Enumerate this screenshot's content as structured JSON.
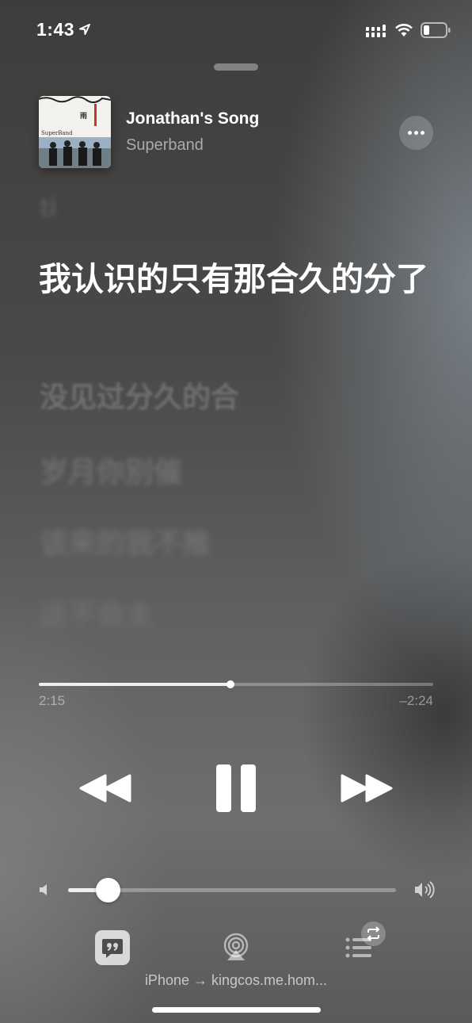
{
  "status_bar": {
    "time": "1:43",
    "icons": [
      "location-arrow-icon",
      "cellular-signal-icon",
      "wifi-icon",
      "battery-icon"
    ]
  },
  "now_playing": {
    "title": "Jonathan's Song",
    "artist": "Superband",
    "album_art": {
      "label": "SuperBand"
    },
    "more_icon": "ellipsis-icon"
  },
  "lyrics": {
    "previous": "ti",
    "current": "我认识的只有那合久的分了",
    "upcoming": [
      "没见过分久的合",
      "岁月你别催",
      "该来的我不推",
      "这不会太"
    ]
  },
  "progress": {
    "elapsed": "2:15",
    "remaining": "–2:24",
    "fraction": 0.485
  },
  "controls": {
    "rewind_icon": "backward-icon",
    "pause_icon": "pause-icon",
    "forward_icon": "forward-icon"
  },
  "volume": {
    "level": 0.12,
    "low_icon": "speaker-low-icon",
    "high_icon": "speaker-high-icon"
  },
  "bottom_bar": {
    "lyrics_icon": "lyrics-quote-icon",
    "airplay_icon": "airplay-icon",
    "queue_icon": "queue-list-icon",
    "repeat_icon": "repeat-icon",
    "route_text": "iPhone → kingcos.me.hom..."
  },
  "colors": {
    "foreground": "#ffffff"
  }
}
